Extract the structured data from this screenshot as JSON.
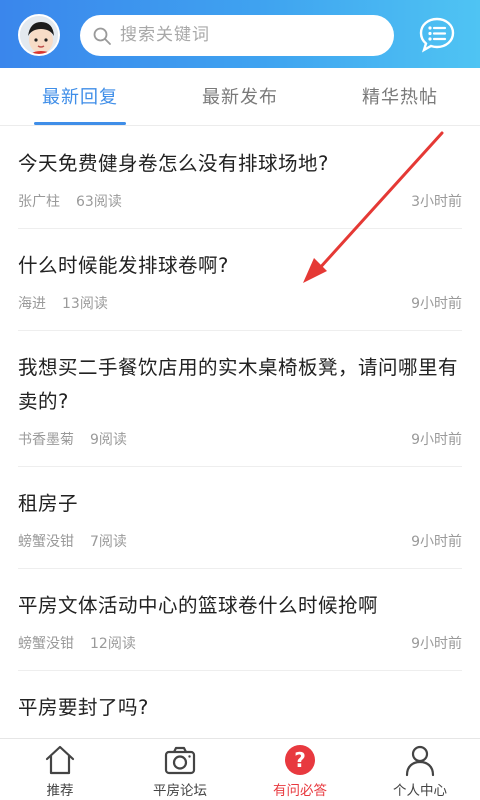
{
  "search": {
    "placeholder": "搜索关键词"
  },
  "tabs": [
    {
      "label": "最新回复",
      "active": true
    },
    {
      "label": "最新发布",
      "active": false
    },
    {
      "label": "精华热帖",
      "active": false
    }
  ],
  "posts": [
    {
      "title": "今天免费健身卷怎么没有排球场地?",
      "author": "张广柱",
      "reads": "63阅读",
      "time": "3小时前"
    },
    {
      "title": "什么时候能发排球卷啊?",
      "author": "海进",
      "reads": "13阅读",
      "time": "9小时前"
    },
    {
      "title": "我想买二手餐饮店用的实木桌椅板凳，请问哪里有卖的?",
      "author": "书香墨菊",
      "reads": "9阅读",
      "time": "9小时前"
    },
    {
      "title": "租房子",
      "author": "螃蟹没钳",
      "reads": "7阅读",
      "time": "9小时前"
    },
    {
      "title": "平房文体活动中心的篮球卷什么时候抢啊",
      "author": "螃蟹没钳",
      "reads": "12阅读",
      "time": "9小时前"
    },
    {
      "title": "平房要封了吗?",
      "author": "",
      "reads": "",
      "time": ""
    }
  ],
  "bottom_nav": [
    {
      "label": "推荐",
      "icon": "home-icon",
      "active": false
    },
    {
      "label": "平房论坛",
      "icon": "camera-icon",
      "active": false
    },
    {
      "label": "有问必答",
      "icon": "question-icon",
      "active": true
    },
    {
      "label": "个人中心",
      "icon": "user-icon",
      "active": false
    }
  ],
  "colors": {
    "header_start": "#3a86ec",
    "header_end": "#4fc4f3",
    "accent": "#3f8ee8",
    "active_nav": "#e8393f",
    "annotation_arrow": "#e53935"
  }
}
